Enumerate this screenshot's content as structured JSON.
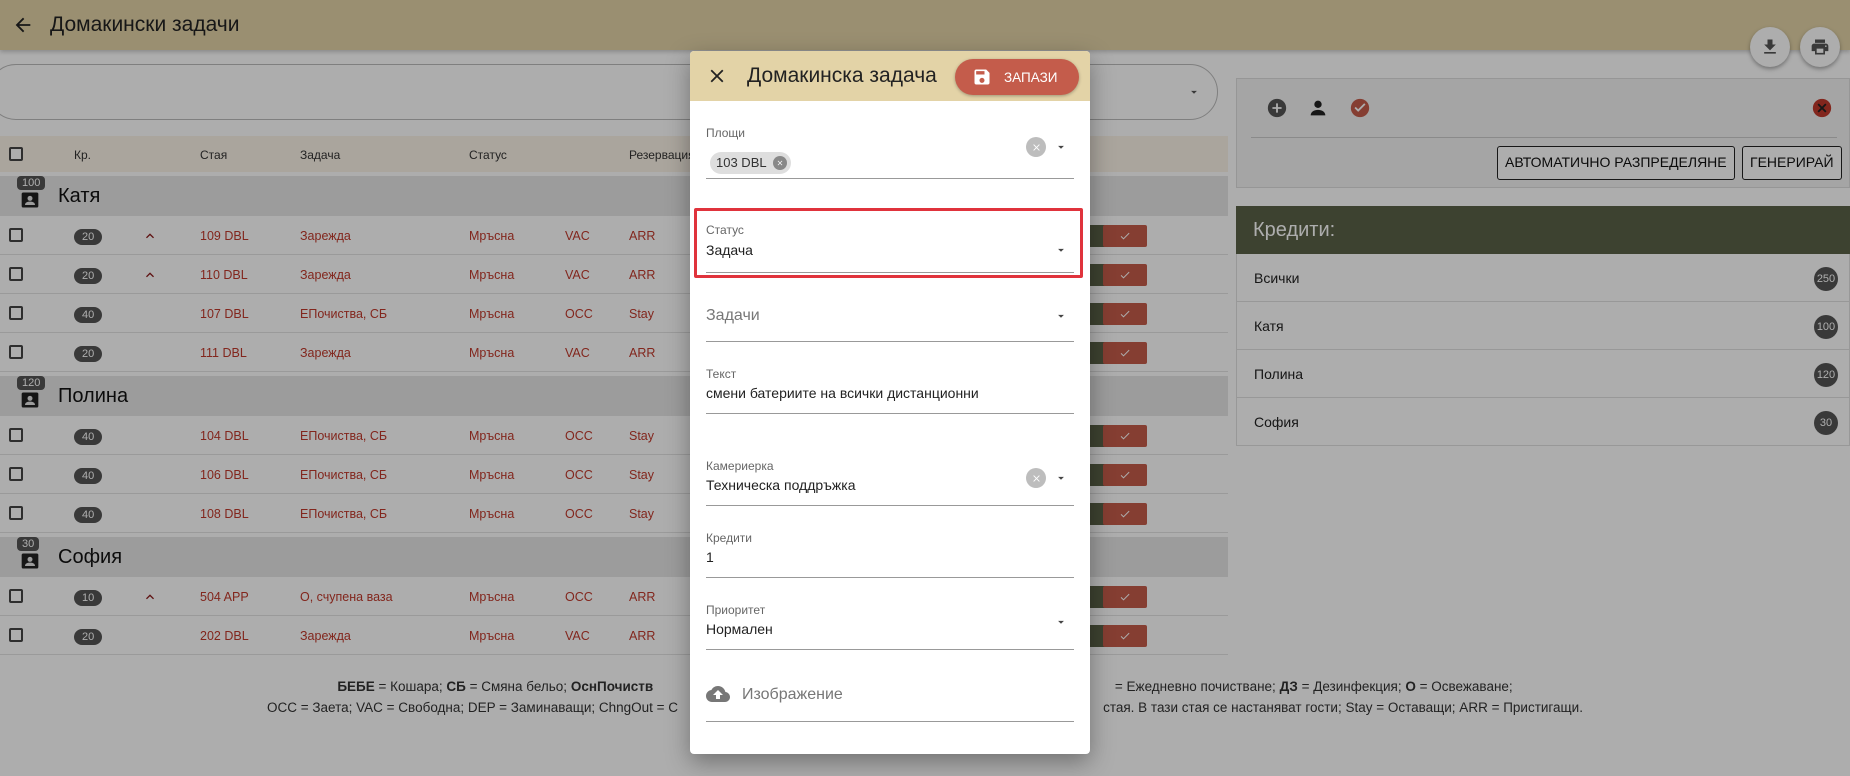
{
  "appbar": {
    "title": "Домакински задачи"
  },
  "table": {
    "headers": [
      "Кр.",
      "Стая",
      "Задача",
      "Статус",
      "Резервация"
    ],
    "groups": [
      {
        "name": "Катя",
        "badge": "100",
        "rows": [
          {
            "credits": "20",
            "priority": true,
            "room": "109 DBL",
            "task": "Зарежда",
            "status": "Мръсна",
            "occ": "VAC",
            "res": "ARR"
          },
          {
            "credits": "20",
            "priority": true,
            "room": "110 DBL",
            "task": "Зарежда",
            "status": "Мръсна",
            "occ": "VAC",
            "res": "ARR"
          },
          {
            "credits": "40",
            "priority": false,
            "room": "107 DBL",
            "task": "ЕПочиства, СБ",
            "status": "Мръсна",
            "occ": "OCC",
            "res": "Stay"
          },
          {
            "credits": "20",
            "priority": false,
            "room": "111 DBL",
            "task": "Зарежда",
            "status": "Мръсна",
            "occ": "VAC",
            "res": "ARR"
          }
        ]
      },
      {
        "name": "Полина",
        "badge": "120",
        "rows": [
          {
            "credits": "40",
            "priority": false,
            "room": "104 DBL",
            "task": "ЕПочиства, СБ",
            "status": "Мръсна",
            "occ": "OCC",
            "res": "Stay"
          },
          {
            "credits": "40",
            "priority": false,
            "room": "106 DBL",
            "task": "ЕПочиства, СБ",
            "status": "Мръсна",
            "occ": "OCC",
            "res": "Stay"
          },
          {
            "credits": "40",
            "priority": false,
            "room": "108 DBL",
            "task": "ЕПочиства, СБ",
            "status": "Мръсна",
            "occ": "OCC",
            "res": "Stay"
          }
        ]
      },
      {
        "name": "София",
        "badge": "30",
        "rows": [
          {
            "credits": "10",
            "priority": true,
            "room": "504 APP",
            "task": "О, счупена ваза",
            "status": "Мръсна",
            "occ": "OCC",
            "res": "ARR"
          },
          {
            "credits": "20",
            "priority": false,
            "room": "202 DBL",
            "task": "Зарежда",
            "status": "Мръсна",
            "occ": "VAC",
            "res": "ARR"
          }
        ]
      }
    ]
  },
  "legend": {
    "line1_a_bold": "БЕБЕ",
    "line1_a": " = Кошара; ",
    "line1_b_bold": "СБ",
    "line1_b": " = Смяна бельо; ",
    "line1_c_bold": "ОснПочиств",
    "line1_d": " = Ежедневно почистване; ",
    "line1_e_bold": "ДЗ",
    "line1_e": " = Дезинфекция; ",
    "line1_f_bold": "О",
    "line1_f": " = Освежаване;",
    "line2_a": "OCC = Заета; VAC = Свободна; DEP = Заминаващи; ChngOut = С",
    "line2_b": "стая. В тази стая се настаняват гости; Stay = Оставащи; ARR = Пристигащи."
  },
  "right_panel": {
    "auto_button": "АВТОМАТИЧНО РАЗПРЕДЕЛЯНЕ",
    "generate_button": "ГЕНЕРИРАЙ"
  },
  "credits": {
    "title": "Кредити:",
    "items": [
      {
        "name": "Всички",
        "value": "250"
      },
      {
        "name": "Катя",
        "value": "100"
      },
      {
        "name": "Полина",
        "value": "120"
      },
      {
        "name": "София",
        "value": "30"
      }
    ]
  },
  "dialog": {
    "title": "Домакинска задача",
    "save_label": "ЗАПАЗИ",
    "areas": {
      "label": "Площи",
      "chip": "103 DBL"
    },
    "status": {
      "label": "Статус",
      "value": "Задача"
    },
    "tasks": {
      "placeholder": "Задачи"
    },
    "text": {
      "label": "Текст",
      "value": "смени батериите на всички дистанционни"
    },
    "maid": {
      "label": "Камериерка",
      "value": "Техническа поддръжка"
    },
    "credits": {
      "label": "Кредити",
      "value": "1"
    },
    "priority": {
      "label": "Приоритет",
      "value": "Нормален"
    },
    "image": {
      "label": "Изображение"
    }
  },
  "colors": {
    "appbar": "#e3d3a7",
    "accent_red": "#c45c4b",
    "credits_header": "#5a6247",
    "highlight": "#e0333c"
  }
}
